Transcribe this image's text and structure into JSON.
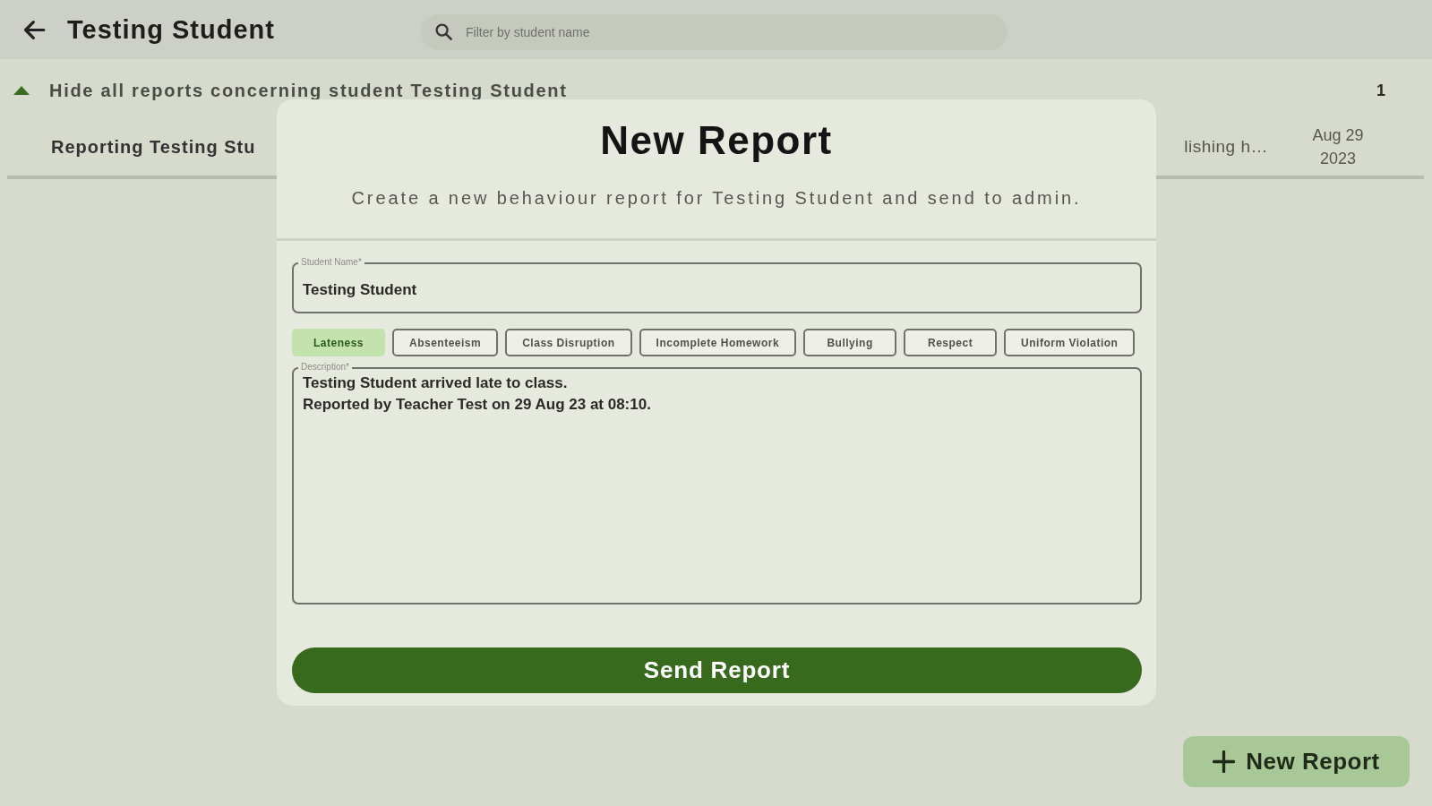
{
  "app_bar": {
    "title": "Testing Student",
    "search": {
      "placeholder": "Filter by student name"
    }
  },
  "report_group": {
    "label": "Hide all reports concerning student Testing Student",
    "expanded": true,
    "count": "1",
    "rows": [
      {
        "title": "Reporting Testing Stu",
        "column_2": "lishing h…",
        "date": "Aug 29 2023"
      }
    ]
  },
  "dialog": {
    "title": "New Report",
    "subtitle": "Create a new behaviour report for Testing Student and send to admin.",
    "student_name": {
      "label": "Student Name*",
      "value": "Testing Student"
    },
    "categories": [
      {
        "label": "Lateness",
        "selected": true
      },
      {
        "label": "Absenteeism",
        "selected": false
      },
      {
        "label": "Class Disruption",
        "selected": false
      },
      {
        "label": "Incomplete Homework",
        "selected": false
      },
      {
        "label": "Bullying",
        "selected": false
      },
      {
        "label": "Respect",
        "selected": false
      },
      {
        "label": "Uniform Violation",
        "selected": false
      }
    ],
    "description": {
      "label": "Description*",
      "value": "Testing Student arrived late to class.\nReported by Teacher Test on 29 Aug 23 at 08:10."
    },
    "send_button": "Send Report"
  },
  "fab": {
    "label": "New Report"
  }
}
